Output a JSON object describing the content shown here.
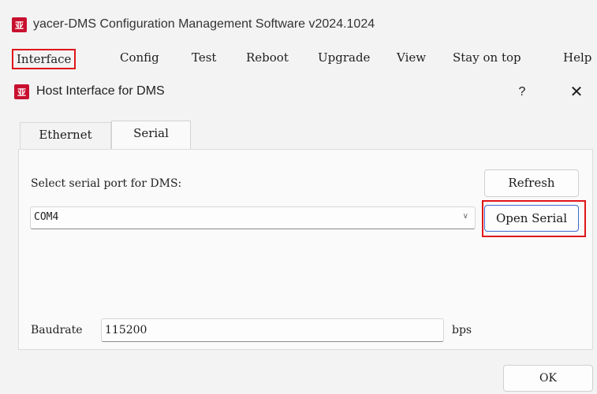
{
  "app": {
    "logo_glyph": "亚",
    "title": "yacer-DMS Configuration Management Software v2024.1024"
  },
  "menu": {
    "items": [
      "Interface",
      "Config",
      "Test",
      "Reboot",
      "Upgrade",
      "View",
      "Stay on top",
      "Help"
    ]
  },
  "dialog": {
    "logo_glyph": "亚",
    "title": "Host Interface for DMS",
    "help_label": "?",
    "close_label": "✕",
    "tabs": [
      "Ethernet",
      "Serial"
    ],
    "active_tab": "Serial",
    "serial": {
      "select_label": "Select serial port for DMS:",
      "refresh_label": "Refresh",
      "port_value": "COM4",
      "open_label": "Open Serial",
      "baud_label": "Baudrate",
      "baud_value": "115200",
      "baud_unit": "bps"
    },
    "ok_label": "OK"
  },
  "colors": {
    "highlight": "#e0161a",
    "logo": "#c8102e",
    "focus_border": "#3d6bd0"
  }
}
